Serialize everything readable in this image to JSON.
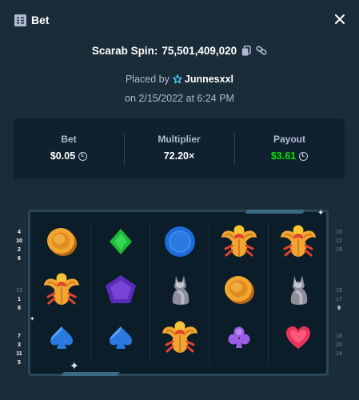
{
  "header": {
    "title": "Bet",
    "icons": {
      "bet": "bet-slip-icon",
      "close": "close-icon"
    }
  },
  "game": {
    "name": "Scarab Spin",
    "separator": ":",
    "bet_id": "75,501,409,020",
    "icons": [
      "copy-icon",
      "link-icon"
    ]
  },
  "placed": {
    "prefix": "Placed by",
    "user": "Junnesxxl",
    "user_icon": "star-icon"
  },
  "date": "on 2/15/2022 at 6:24 PM",
  "stats": {
    "bet": {
      "label": "Bet",
      "value": "$0.05",
      "currency_icon": "litecoin-icon"
    },
    "multiplier": {
      "label": "Multiplier",
      "value": "72.20×"
    },
    "payout": {
      "label": "Payout",
      "value": "$3.61",
      "currency_icon": "litecoin-icon",
      "color": "#00e701"
    }
  },
  "board": {
    "reels": [
      [
        "gold-coin",
        "scarab",
        "spade"
      ],
      [
        "green-diamond",
        "purple-pentagon",
        "spade"
      ],
      [
        "blue-ring",
        "cat-statue",
        "scarab"
      ],
      [
        "scarab",
        "gold-coin",
        "club"
      ],
      [
        "scarab",
        "cat-statue",
        "heart"
      ]
    ],
    "paylines_left": [
      [
        "4",
        "10",
        "2",
        "6"
      ],
      [
        "13",
        "1",
        "8"
      ],
      [
        "7",
        "3",
        "11",
        "5"
      ]
    ],
    "paylines_right": [
      [
        "15",
        "12",
        "19"
      ],
      [
        "16",
        "17",
        "9"
      ],
      [
        "18",
        "20",
        "14"
      ]
    ]
  },
  "colors": {
    "background": "#1a2c38",
    "panel": "#0f212e",
    "muted_text": "#b1bad3",
    "win_green": "#00e701"
  }
}
